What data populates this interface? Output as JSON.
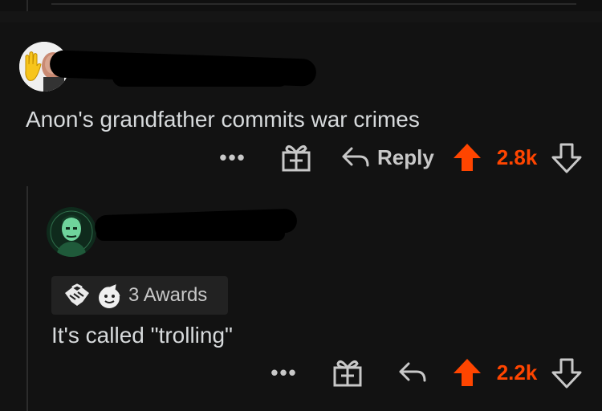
{
  "colors": {
    "accent": "#ff4500",
    "background": "#121212",
    "text": "#d7dadc",
    "muted": "#c8c8c8"
  },
  "comment1": {
    "body": "Anon's grandfather commits war crimes",
    "actions": {
      "more": "•••",
      "reply_label": "Reply",
      "score": "2.8k"
    },
    "icons": [
      "avatar-hand-icon",
      "gift-icon",
      "reply-arrow-icon",
      "upvote-icon",
      "downvote-icon"
    ]
  },
  "comment2": {
    "awards_label": "3 Awards",
    "body": "It's called \"trolling\"",
    "actions": {
      "more": "•••",
      "score": "2.2k"
    },
    "icons": [
      "handshake-award-icon",
      "wholesome-award-icon",
      "gift-icon",
      "reply-arrow-icon",
      "upvote-icon",
      "downvote-icon"
    ]
  }
}
